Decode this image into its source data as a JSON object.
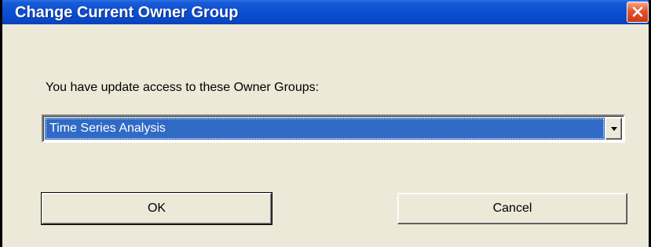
{
  "window": {
    "title": "Change Current Owner Group",
    "close_icon": "close-icon"
  },
  "form": {
    "prompt": "You have update access to these Owner Groups:",
    "owner_group_selected": "Time Series Analysis"
  },
  "buttons": {
    "ok_label": "OK",
    "cancel_label": "Cancel"
  },
  "colors": {
    "titlebar": "#0a49c9",
    "selection": "#316ac5",
    "dialog_bg": "#ece9d8",
    "close_button": "#e2532b"
  }
}
